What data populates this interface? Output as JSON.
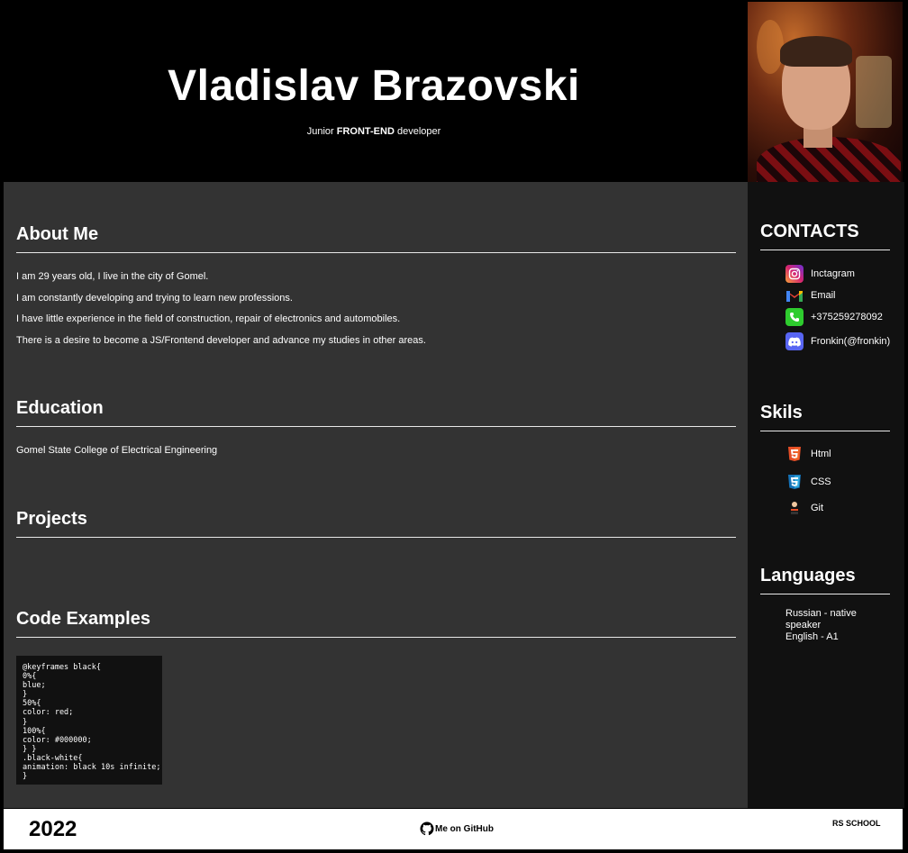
{
  "header": {
    "name": "Vladislav Brazovski",
    "subtitle_pre": "Junior ",
    "subtitle_bold": "FRONT-END",
    "subtitle_post": " developer"
  },
  "about": {
    "title": "About Me",
    "lines": [
      "I am 29 years old, I live in the city of Gomel.",
      "I am constantly developing and trying to learn new professions.",
      "I have little experience in the field of construction, repair of electronics and automobiles.",
      "There is a desire to become a JS/Frontend developer and advance my studies in other areas."
    ]
  },
  "education": {
    "title": "Education",
    "text": "Gomel State College of Electrical Engineering"
  },
  "projects": {
    "title": "Projects"
  },
  "code_examples": {
    "title": "Code Examples",
    "code": "@keyframes black{\n0%{\nblue;\n}\n50%{\ncolor: red;\n}\n100%{\ncolor: #000000;\n} }\n.black-white{\nanimation: black 10s infinite;\n}"
  },
  "contacts": {
    "title": "CONTACTS",
    "items": [
      {
        "label": "Inctagram",
        "icon": "instagram-icon"
      },
      {
        "label": "Email",
        "icon": "gmail-icon"
      },
      {
        "label": "+375259278092",
        "icon": "phone-icon"
      },
      {
        "label": "Fronkin(@fronkin)",
        "icon": "discord-icon"
      }
    ]
  },
  "skills": {
    "title": "Skils",
    "items": [
      {
        "label": "Html",
        "icon": "html5-icon"
      },
      {
        "label": "CSS",
        "icon": "css3-icon"
      },
      {
        "label": "Git",
        "icon": "git-icon"
      }
    ]
  },
  "languages": {
    "title": "Languages",
    "lines": [
      "Russian - native speaker",
      "English -  A1"
    ]
  },
  "footer": {
    "year": "2022",
    "github_label": "Me on GitHub",
    "school_logo": "RS SCHOOL"
  },
  "colors": {
    "main_bg": "#333333",
    "sidebar_bg": "#111111",
    "header_bg": "#000000",
    "footer_bg": "#ffffff"
  }
}
